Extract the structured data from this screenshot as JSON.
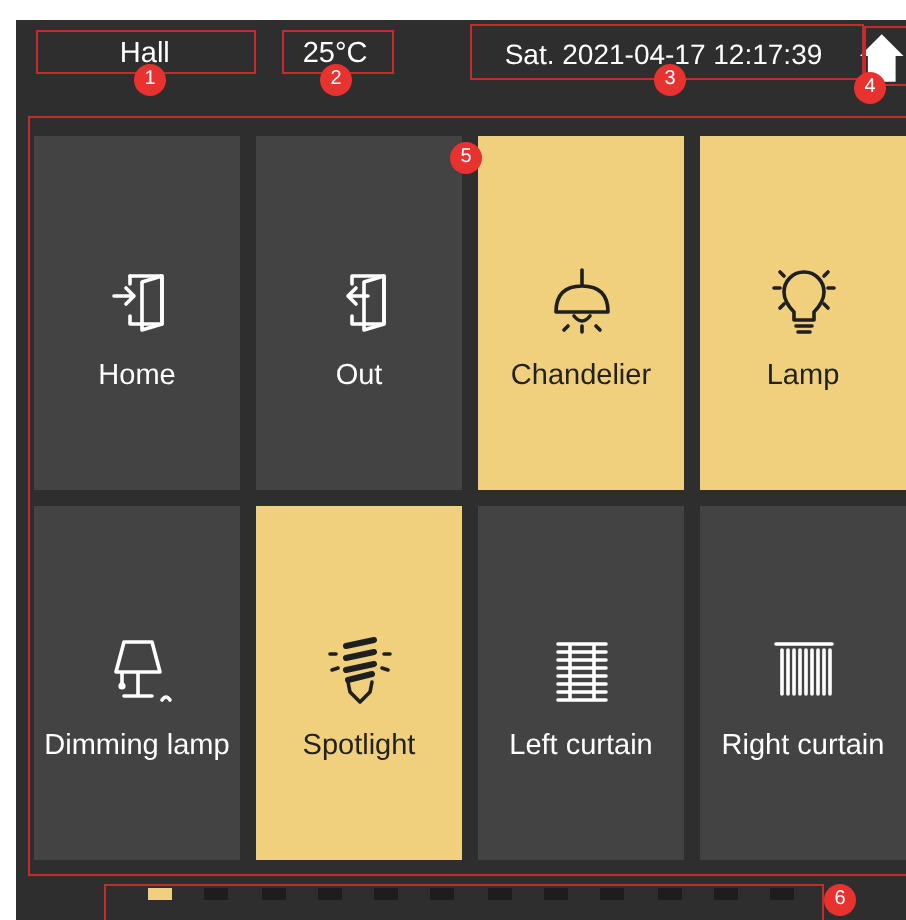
{
  "header": {
    "room": "Hall",
    "temperature": "25°C",
    "datetime": "Sat. 2021-04-17 12:17:39"
  },
  "tiles": [
    {
      "label": "Home",
      "on": false,
      "kind": "enter"
    },
    {
      "label": "Out",
      "on": false,
      "kind": "exit"
    },
    {
      "label": "Chandelier",
      "on": true,
      "kind": "chandelier"
    },
    {
      "label": "Lamp",
      "on": true,
      "kind": "bulb"
    },
    {
      "label": "Dimming lamp",
      "on": false,
      "kind": "table-lamp"
    },
    {
      "label": "Spotlight",
      "on": true,
      "kind": "spiral-bulb"
    },
    {
      "label": "Left curtain",
      "on": false,
      "kind": "blind"
    },
    {
      "label": "Right curtain",
      "on": false,
      "kind": "curtain"
    }
  ],
  "pages": [
    {
      "selected": true
    },
    {
      "selected": false
    },
    {
      "selected": false
    },
    {
      "selected": false
    },
    {
      "selected": false
    },
    {
      "selected": false
    },
    {
      "selected": false
    },
    {
      "selected": false
    },
    {
      "selected": false
    },
    {
      "selected": false
    },
    {
      "selected": false
    },
    {
      "selected": false
    }
  ],
  "callouts": [
    {
      "number": "1"
    },
    {
      "number": "2"
    },
    {
      "number": "3"
    },
    {
      "number": "4"
    },
    {
      "number": "5"
    },
    {
      "number": "6"
    }
  ]
}
